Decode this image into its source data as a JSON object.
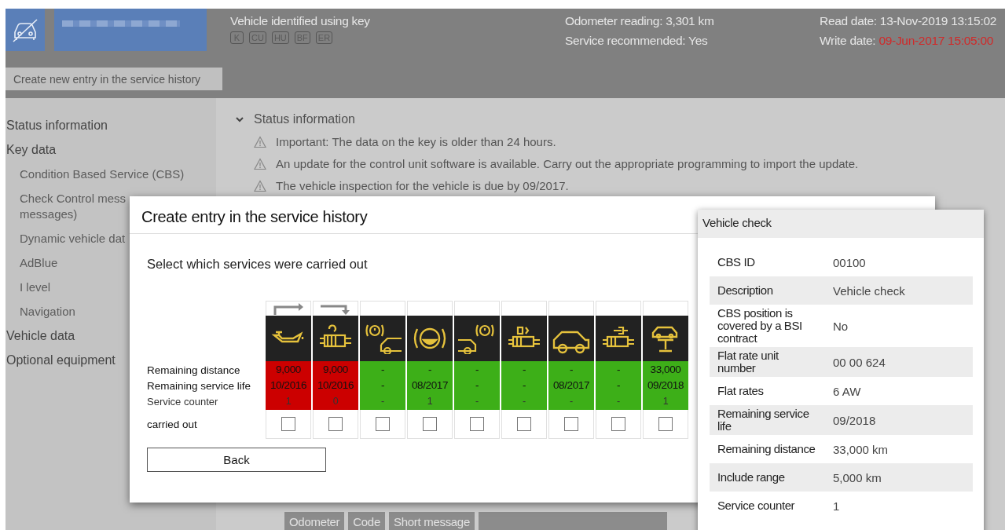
{
  "header": {
    "identified_label": "Vehicle identified using key",
    "key_badges": [
      "K",
      "CU",
      "HU",
      "BF",
      "ER"
    ],
    "odometer": "Odometer reading: 3,301 km",
    "service_recommended": "Service recommended: Yes",
    "read_date": "Read date: 13-Nov-2019 13:15:02",
    "write_date_label": "Write date:",
    "write_date_value": "09-Jun-2017 15:05:00",
    "create_entry_button": "Create new entry in the service history"
  },
  "sidebar": {
    "items": [
      {
        "label": "Status information"
      },
      {
        "label": "Key data",
        "children": [
          {
            "lines": [
              "Condition Based Service (CBS)"
            ]
          },
          {
            "lines": [
              "Check Control mess",
              "messages)"
            ]
          },
          {
            "lines": [
              "Dynamic vehicle dat"
            ]
          },
          {
            "lines": [
              "AdBlue"
            ]
          },
          {
            "lines": [
              "I level"
            ]
          },
          {
            "lines": [
              "Navigation"
            ]
          }
        ]
      },
      {
        "label": "Vehicle data"
      },
      {
        "label": "Optional equipment"
      }
    ]
  },
  "status_section": {
    "title": "Status information",
    "expanded": true,
    "warnings": [
      "Important: The data on the key is older than 24 hours.",
      "An update for the control unit software is available. Carry out the appropriate programming to import the update.",
      "The vehicle inspection for the vehicle is due by 09/2017."
    ]
  },
  "bottom_tabs": [
    "Odometer",
    "Code",
    "Short message"
  ],
  "dialog": {
    "title": "Create entry in the service history",
    "instruction": "Select which services were carried out",
    "row_labels": [
      "Remaining distance",
      "Remaining service life",
      "Service counter",
      "carried out"
    ],
    "services": [
      {
        "kind": "turn-right",
        "color": "#cc0000",
        "remaining_distance": "9,000",
        "remaining_life": "10/2016",
        "counter": "1",
        "checked": false
      },
      {
        "kind": "turn-down",
        "color": "#cc0000",
        "remaining_distance": "9,000",
        "remaining_life": "10/2016",
        "counter": "0",
        "checked": false
      },
      {
        "kind": "plain",
        "color": "#3daf18",
        "remaining_distance": "-",
        "remaining_life": "-",
        "counter": "-",
        "checked": false
      },
      {
        "kind": "plain",
        "color": "#3daf18",
        "remaining_distance": "-",
        "remaining_life": "08/2017",
        "counter": "1",
        "checked": false
      },
      {
        "kind": "plain",
        "color": "#3daf18",
        "remaining_distance": "-",
        "remaining_life": "-",
        "counter": "-",
        "checked": false
      },
      {
        "kind": "plain",
        "color": "#3daf18",
        "remaining_distance": "-",
        "remaining_life": "-",
        "counter": "-",
        "checked": false
      },
      {
        "kind": "plain",
        "color": "#3daf18",
        "remaining_distance": "-",
        "remaining_life": "08/2017",
        "counter": "-",
        "checked": false
      },
      {
        "kind": "plain",
        "color": "#3daf18",
        "remaining_distance": "-",
        "remaining_life": "-",
        "counter": "-",
        "checked": false
      },
      {
        "kind": "plain",
        "color": "#3daf18",
        "remaining_distance": "33,000",
        "remaining_life": "09/2018",
        "counter": "1",
        "checked": false
      }
    ],
    "back_button": "Back"
  },
  "detail_popup": {
    "title": "Vehicle check",
    "rows": [
      {
        "label": "CBS ID",
        "value": "00100"
      },
      {
        "label": "Description",
        "value": "Vehicle check"
      },
      {
        "label": "CBS position is covered by a BSI contract",
        "value": "No"
      },
      {
        "label": "Flat rate unit number",
        "value": "00 00 624"
      },
      {
        "label": "Flat rates",
        "value": "6 AW"
      },
      {
        "label": "Remaining service life",
        "value": "09/2018"
      },
      {
        "label": "Remaining distance",
        "value": "33,000 km"
      },
      {
        "label": "Include range",
        "value": "5,000 km"
      },
      {
        "label": "Service counter",
        "value": "1"
      }
    ]
  }
}
